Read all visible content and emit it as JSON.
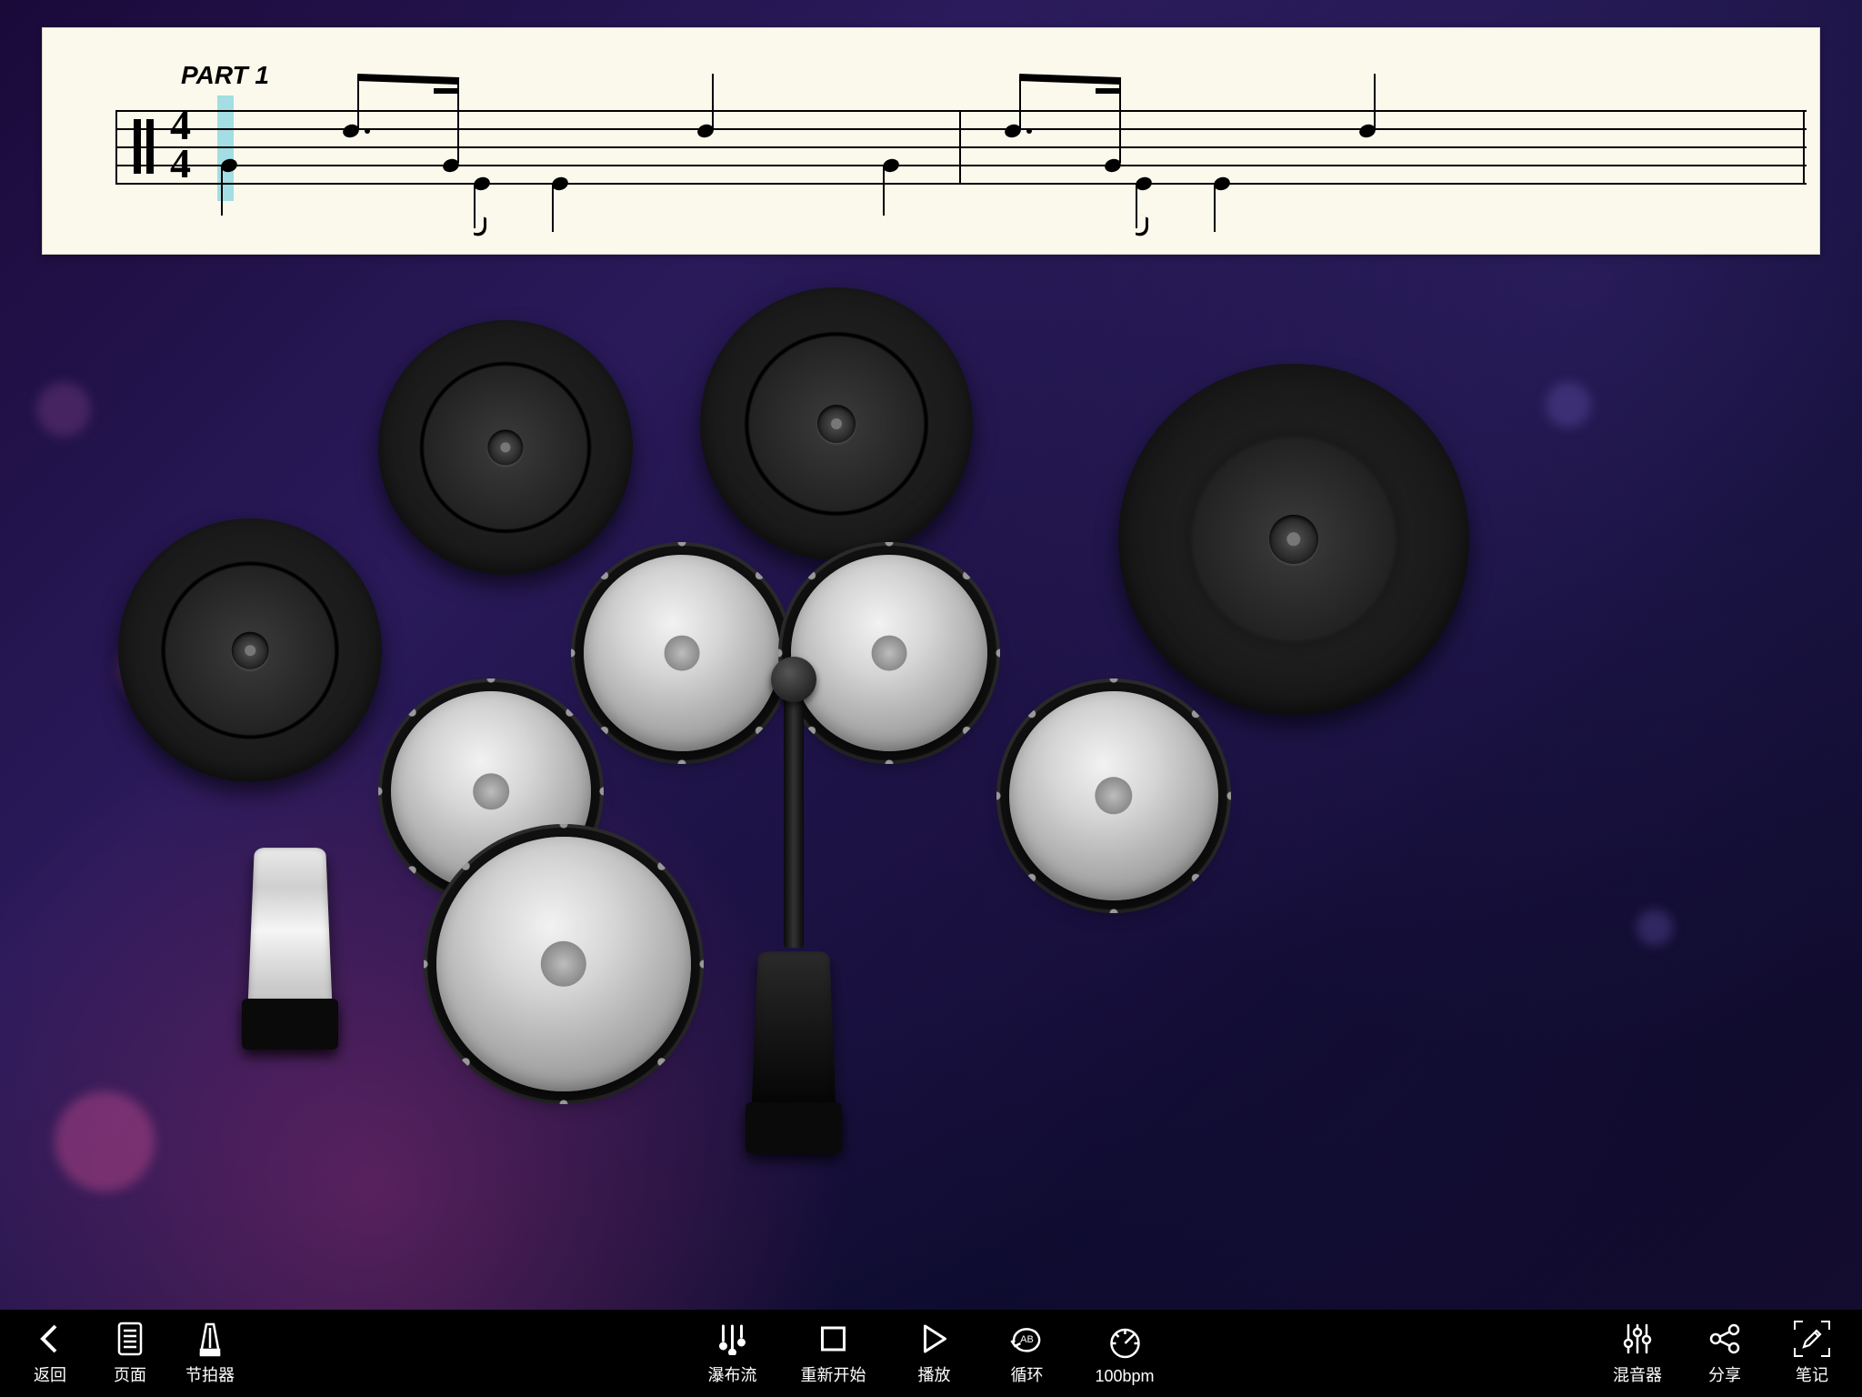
{
  "score": {
    "part_label": "PART 1",
    "time_sig_top": "4",
    "time_sig_bot": "4"
  },
  "drumkit": {
    "pieces": [
      {
        "name": "crash-cymbal-1"
      },
      {
        "name": "crash-cymbal-2"
      },
      {
        "name": "ride-cymbal"
      },
      {
        "name": "hihat-cymbal"
      },
      {
        "name": "tom-high"
      },
      {
        "name": "tom-mid"
      },
      {
        "name": "tom-floor"
      },
      {
        "name": "snare-small"
      },
      {
        "name": "snare-large"
      },
      {
        "name": "hihat-pedal"
      },
      {
        "name": "kick-pedal"
      }
    ]
  },
  "toolbar": {
    "left": [
      {
        "key": "back",
        "label": "返回",
        "icon": "chevron-left"
      },
      {
        "key": "page",
        "label": "页面",
        "icon": "page"
      },
      {
        "key": "metronome",
        "label": "节拍器",
        "icon": "metronome"
      }
    ],
    "center": [
      {
        "key": "waterfall",
        "label": "瀑布流",
        "icon": "waterfall"
      },
      {
        "key": "restart",
        "label": "重新开始",
        "icon": "stop"
      },
      {
        "key": "play",
        "label": "播放",
        "icon": "play"
      },
      {
        "key": "loop",
        "label": "循环",
        "icon": "loop-ab"
      },
      {
        "key": "tempo",
        "label": "100bpm",
        "icon": "gauge"
      }
    ],
    "right": [
      {
        "key": "mixer",
        "label": "混音器",
        "icon": "mixer"
      },
      {
        "key": "share",
        "label": "分享",
        "icon": "share"
      },
      {
        "key": "notes",
        "label": "笔记",
        "icon": "pencil"
      }
    ]
  }
}
